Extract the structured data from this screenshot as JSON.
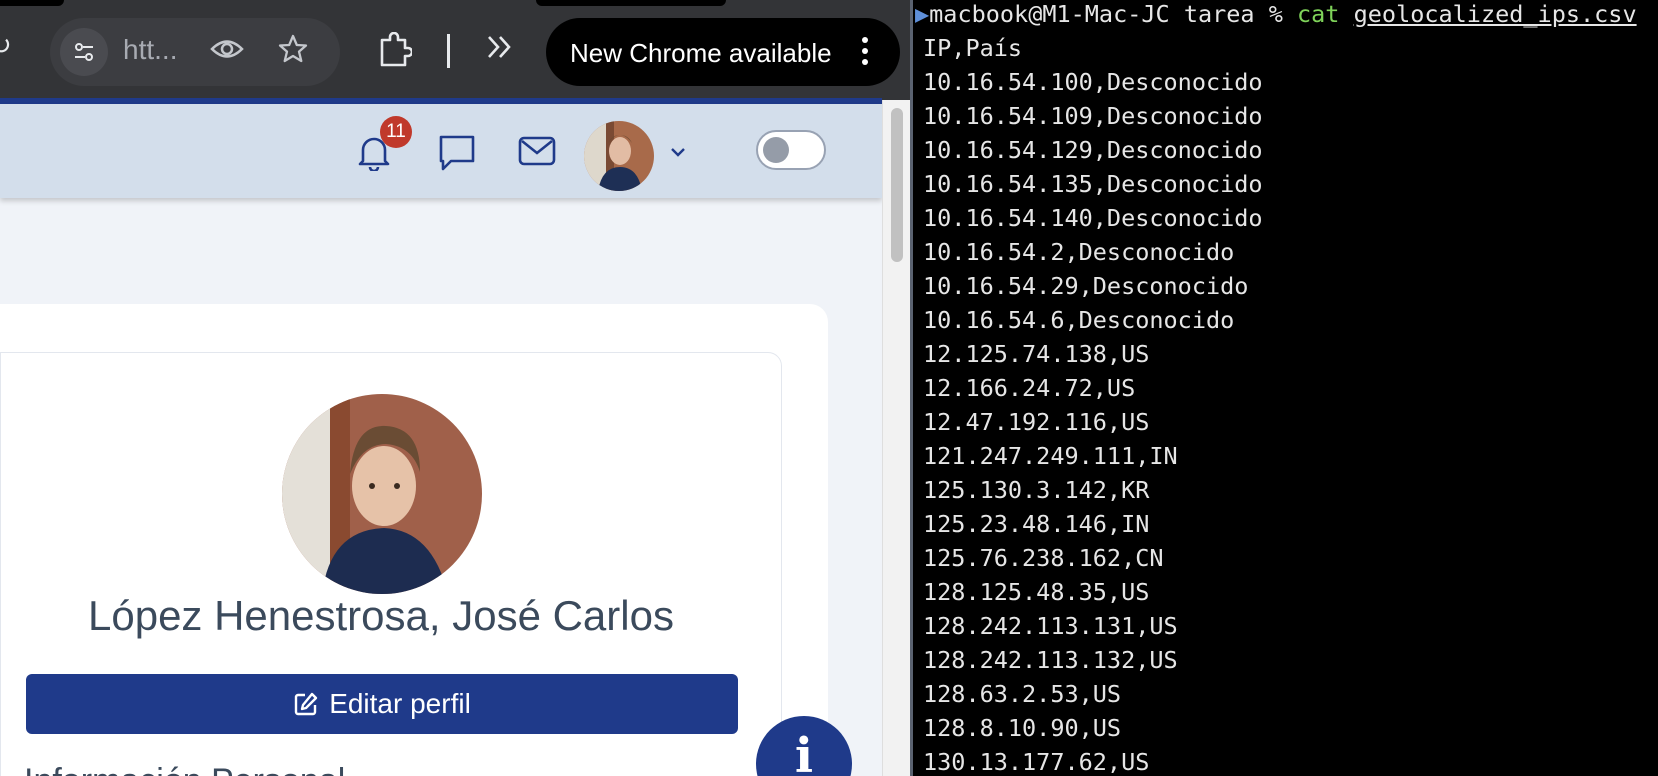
{
  "browser": {
    "address_bar": {
      "url_truncated": "htt..."
    },
    "update_pill": {
      "label": "New Chrome available"
    },
    "icons": [
      "reload-icon",
      "site-info-icon",
      "eye-icon",
      "star-icon",
      "extension-icon",
      "more-tools-icon",
      "kebab-icon"
    ]
  },
  "app": {
    "notifications": {
      "count": "11"
    },
    "profile": {
      "name": "López Henestrosa, José Carlos",
      "edit_label": "Editar perfil",
      "section_heading": "Información Personal"
    },
    "info_fab_label": "i",
    "colors": {
      "primary": "#1f3a8a",
      "header_bg": "#d3deeb",
      "badge": "#c0392b"
    }
  },
  "terminal": {
    "prompt": "macbook@M1-Mac-JC tarea % ",
    "command": "cat",
    "argument": "geolocalized_ips.csv",
    "lines": [
      "IP,País",
      "10.16.54.100,Desconocido",
      "10.16.54.109,Desconocido",
      "10.16.54.129,Desconocido",
      "10.16.54.135,Desconocido",
      "10.16.54.140,Desconocido",
      "10.16.54.2,Desconocido",
      "10.16.54.29,Desconocido",
      "10.16.54.6,Desconocido",
      "12.125.74.138,US",
      "12.166.24.72,US",
      "12.47.192.116,US",
      "121.247.249.111,IN",
      "125.130.3.142,KR",
      "125.23.48.146,IN",
      "125.76.238.162,CN",
      "128.125.48.35,US",
      "128.242.113.131,US",
      "128.242.113.132,US",
      "128.63.2.53,US",
      "128.8.10.90,US",
      "130.13.177.62,US"
    ],
    "colors": {
      "command": "#7fd35a",
      "text": "#e6e6e6"
    }
  }
}
